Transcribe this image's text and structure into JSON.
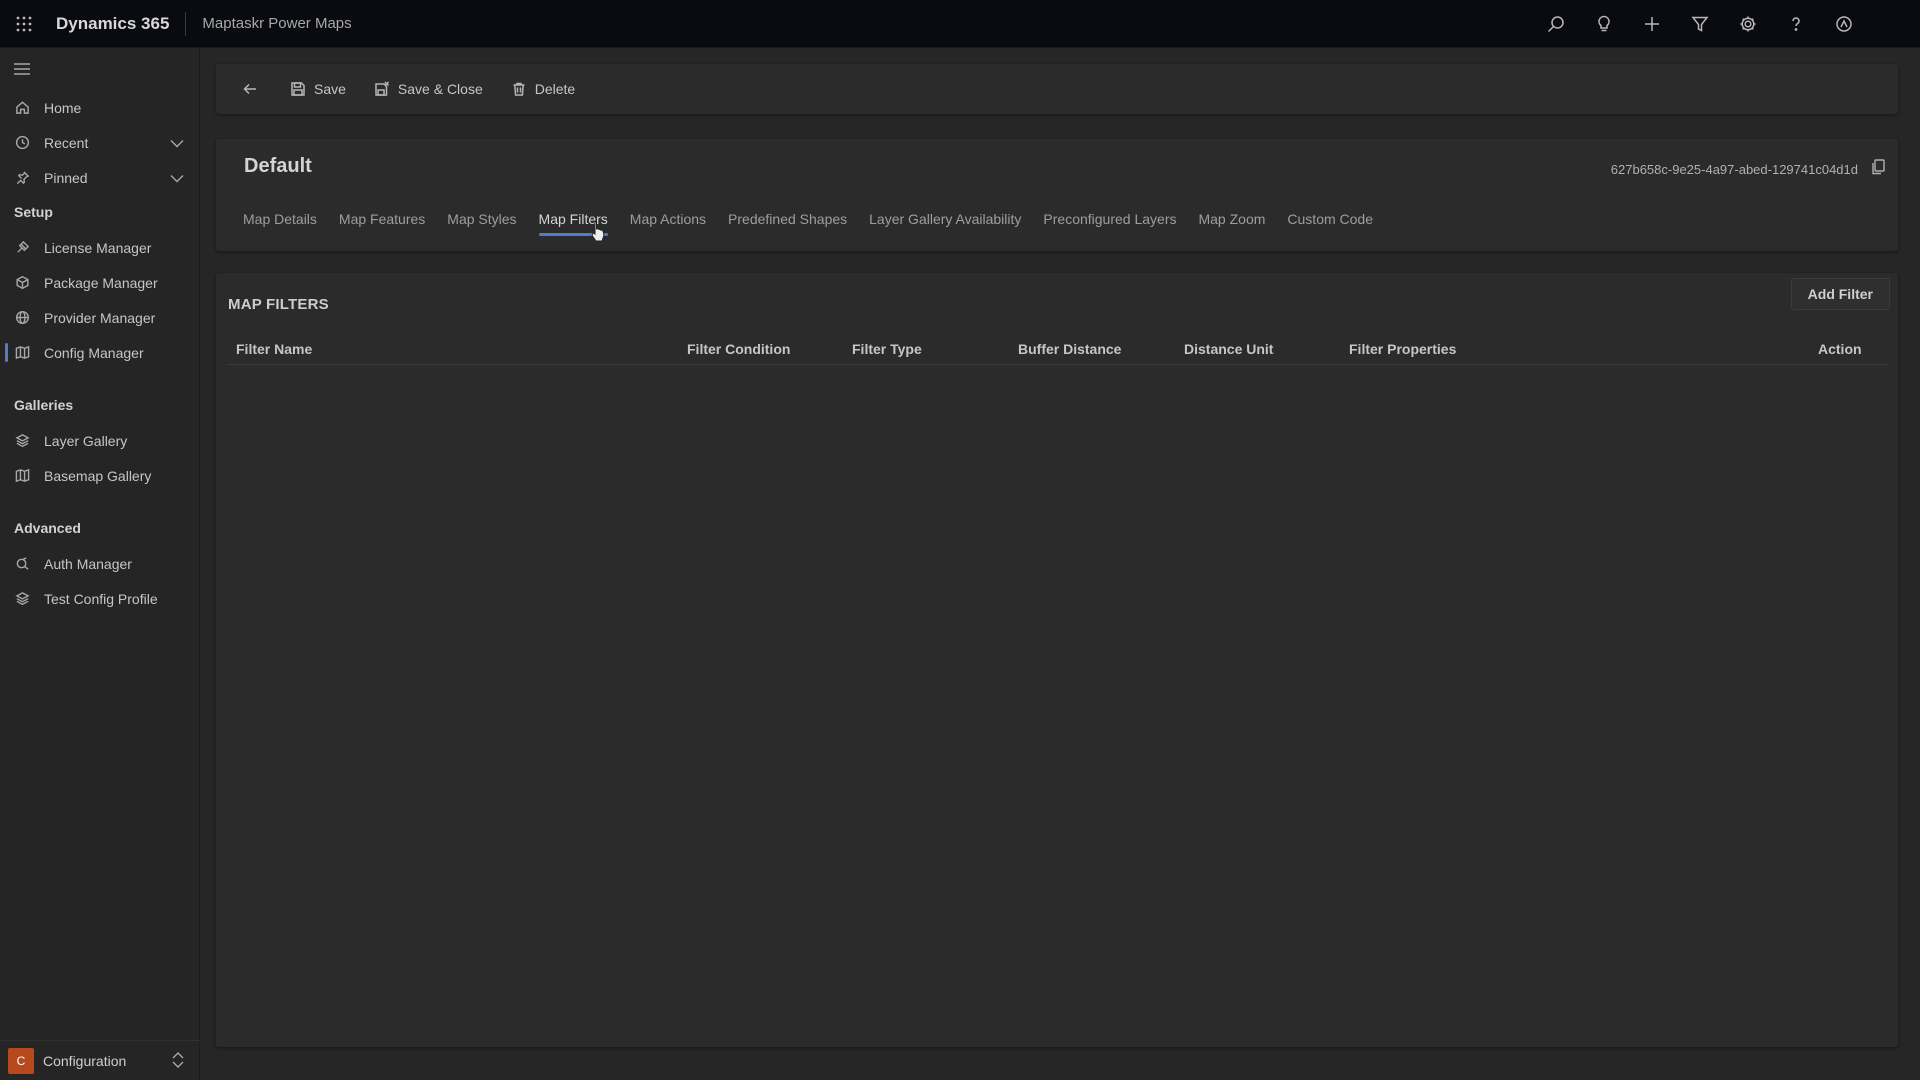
{
  "topbar": {
    "brand": "Dynamics 365",
    "app_name": "Maptaskr Power Maps",
    "actions": [
      "search-icon",
      "lightbulb-icon",
      "plus-icon",
      "filter-icon",
      "gear-icon",
      "help-icon",
      "copilot-icon"
    ]
  },
  "sidebar": {
    "items_top": [
      {
        "label": "Home",
        "icon": "home-icon"
      },
      {
        "label": "Recent",
        "icon": "clock-icon",
        "expandable": true
      },
      {
        "label": "Pinned",
        "icon": "pin-icon",
        "expandable": true
      }
    ],
    "sections": [
      {
        "header": "Setup",
        "items": [
          {
            "label": "License Manager",
            "icon": "license-icon"
          },
          {
            "label": "Package Manager",
            "icon": "package-icon"
          },
          {
            "label": "Provider Manager",
            "icon": "globe-icon"
          },
          {
            "label": "Config Manager",
            "icon": "map-icon",
            "active": true
          }
        ]
      },
      {
        "header": "Galleries",
        "items": [
          {
            "label": "Layer Gallery",
            "icon": "layers-icon"
          },
          {
            "label": "Basemap Gallery",
            "icon": "map-icon"
          }
        ]
      },
      {
        "header": "Advanced",
        "items": [
          {
            "label": "Auth Manager",
            "icon": "auth-icon"
          },
          {
            "label": "Test Config Profile",
            "icon": "layers-icon"
          }
        ]
      }
    ],
    "area": {
      "badge": "C",
      "label": "Configuration"
    }
  },
  "commandbar": {
    "save": "Save",
    "save_close": "Save & Close",
    "delete": "Delete"
  },
  "record": {
    "title": "Default",
    "id": "627b658c-9e25-4a97-abed-129741c04d1d"
  },
  "tabs": [
    {
      "label": "Map Details"
    },
    {
      "label": "Map Features"
    },
    {
      "label": "Map Styles"
    },
    {
      "label": "Map Filters",
      "active": true
    },
    {
      "label": "Map Actions"
    },
    {
      "label": "Predefined Shapes"
    },
    {
      "label": "Layer Gallery Availability"
    },
    {
      "label": "Preconfigured Layers"
    },
    {
      "label": "Map Zoom"
    },
    {
      "label": "Custom Code"
    }
  ],
  "map_filters": {
    "title": "MAP FILTERS",
    "add_button": "Add Filter",
    "columns": [
      "Filter Name",
      "Filter Condition",
      "Filter Type",
      "Buffer Distance",
      "Distance Unit",
      "Filter Properties",
      "Action"
    ],
    "rows": []
  },
  "colors": {
    "accent": "#4f7ecb",
    "area_badge": "#b8491c",
    "topbar": "#0a0b10"
  }
}
